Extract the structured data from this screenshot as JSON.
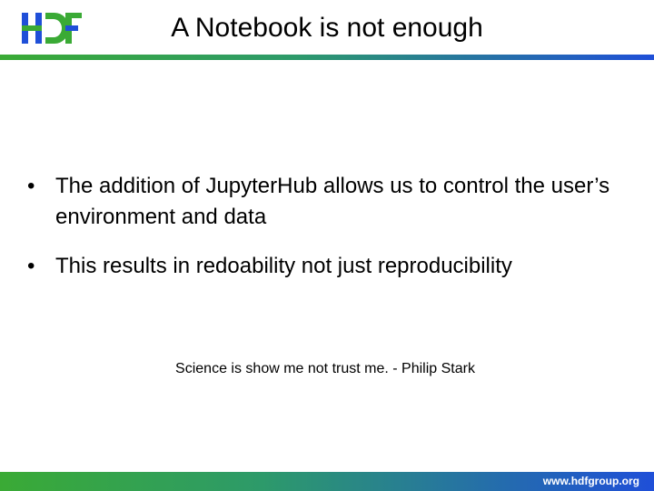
{
  "slide": {
    "title": "A Notebook is not enough",
    "logo_text": "HDF",
    "bullets": [
      "The addition of JupyterHub allows us to control the user’s environment and data",
      "This results in redoability not just reproducibility"
    ],
    "quote": "Science is show me not trust me. - Philip Stark",
    "footer_url": "www.hdfgroup.org"
  },
  "colors": {
    "green": "#3aaa35",
    "blue": "#1f4fd8",
    "text": "#000000"
  }
}
